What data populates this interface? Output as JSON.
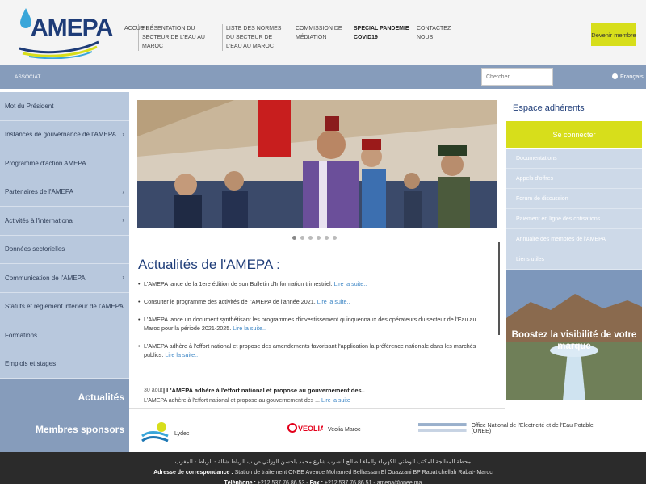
{
  "header": {
    "logo_text": "AMEPA",
    "nav": [
      {
        "label": "ACCUEIL"
      },
      {
        "label": "PRÉSENTATION DU SECTEUR DE L'EAU AU MAROC"
      },
      {
        "label": "LISTE DES NORMES DU SECTEUR DE L'EAU AU MAROC"
      },
      {
        "label": "COMMISSION DE MÉDIATION"
      },
      {
        "label": "SPECIAL PANDEMIE COVID19"
      },
      {
        "label": "CONTACTEZ NOUS"
      }
    ],
    "become_member": "Devenir membre",
    "brand_color": "#1e3c78",
    "accent_color": "#d7de1b"
  },
  "topbar": {
    "left_text": "ASSOCIAT",
    "search_placeholder": "Chercher...",
    "language": "Français"
  },
  "sidebar": {
    "items": [
      {
        "label": "Mot du Président",
        "has_arrow": false
      },
      {
        "label": "Instances de gouvernance de l'AMEPA",
        "has_arrow": true
      },
      {
        "label": "Programme d'action AMEPA",
        "has_arrow": false
      },
      {
        "label": "Partenaires de l'AMEPA",
        "has_arrow": true
      },
      {
        "label": "Activités à l'international",
        "has_arrow": true
      },
      {
        "label": "Données sectorielles",
        "has_arrow": false
      },
      {
        "label": "Communication de l'AMEPA",
        "has_arrow": true
      },
      {
        "label": "Statuts et règlement intérieur de l'AMEPA",
        "has_arrow": false
      },
      {
        "label": "Formations",
        "has_arrow": false
      },
      {
        "label": "Emplois et stages",
        "has_arrow": false
      }
    ],
    "actualites_label": "Actualités",
    "sponsors_label": "Membres sponsors"
  },
  "slider": {
    "dot_count": 6,
    "active_index": 0
  },
  "news": {
    "title": "Actualités de l'AMEPA :",
    "items": [
      {
        "text": "L'AMEPA lance de la 1ere édition de son Bulletin d'Information trimestriel.",
        "more": "Lire la suite.."
      },
      {
        "text": "Consulter le programme des activités de l'AMEPA de l'année 2021.",
        "more": "Lire la suite.."
      },
      {
        "text": "L'AMEPA lance un document synthétisant les programmes d'investissement quinquennaux des opérateurs du secteur de l'Eau au Maroc pour la période 2021-2025.",
        "more": "Lire la suite.."
      },
      {
        "text": "L'AMEPA adhère à l'effort national et propose des amendements favorisant l'application la préférence nationale dans les marchés publics.",
        "more": "Lire la suite.."
      }
    ]
  },
  "ticker": {
    "date": "30 aout",
    "title": "| L'AMEPA adhère à l'effort national et propose au gouvernement des..",
    "text": "L'AMEPA adhère à l'effort national et propose au gouvernement des ...",
    "more": "Lire la suite"
  },
  "sponsors": [
    {
      "name": "Lydec",
      "logo_text": "Lydec"
    },
    {
      "name": "Veolia Maroc",
      "logo_text": "VEOLIA"
    },
    {
      "name": "Office National de l'Electricité et de l'Eau Potable (ONEE)",
      "logo_text": "ONEE"
    }
  ],
  "member_area": {
    "title": "Espace adhérents",
    "login": "Se connecter",
    "links": [
      "Documentations",
      "Appels d'offres",
      "Forum de discussion",
      "Paiement en ligne des cotisations",
      "Annuaire des membres de l'AMEPA",
      "Liens utiles"
    ]
  },
  "promo": {
    "text": "Boostez la visibilité de votre marque"
  },
  "footer": {
    "arabic_line": "محطة المعالجة للمكتب الوطني للكهرباء والماء الصالح للشرب شارع محمد بلحسن الوزاني ص ب الرباط شالة - الرباط - المغرب",
    "address_label": "Adresse de correspondance :",
    "address": "Station de traitement ONEE Avenue Mohamed Belhassan El Ouazzani BP Rabat chellah Rabat- Maroc",
    "phone_label": "Téléphone :",
    "phone": "+212 537 76 86 53 -",
    "fax_label": "Fax :",
    "fax": "+212 537 76 86 51 -",
    "email": "amepa@onee.ma"
  }
}
